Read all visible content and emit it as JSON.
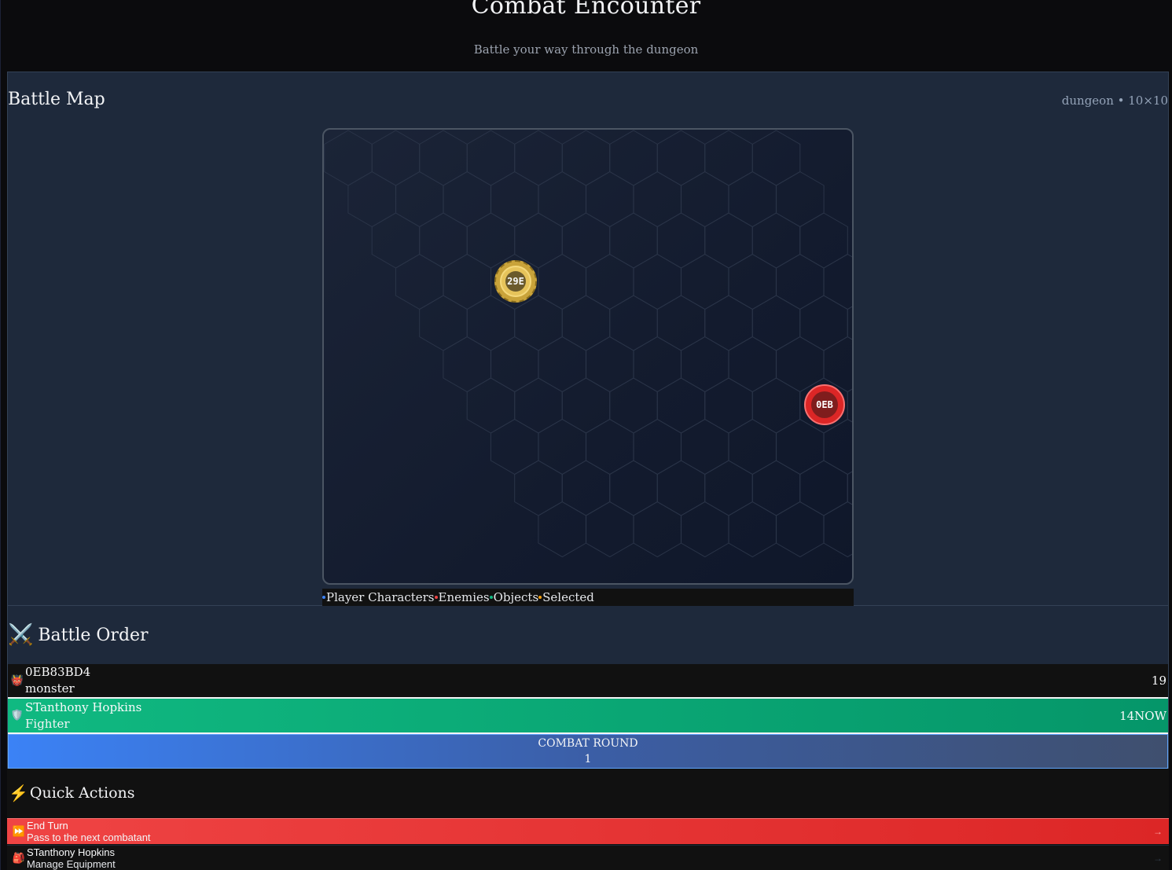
{
  "header": {
    "title": "Combat Encounter",
    "subtitle": "Battle your way through the dungeon"
  },
  "map": {
    "title": "Battle Map",
    "meta": "dungeon • 10×10",
    "tokens": [
      {
        "label": "29E",
        "kind": "player"
      },
      {
        "label": "0EB",
        "kind": "enemy"
      }
    ],
    "legend": [
      {
        "label": "Player Characters",
        "color": "#3b82f6"
      },
      {
        "label": "Enemies",
        "color": "#ef4444"
      },
      {
        "label": "Objects",
        "color": "#10b981"
      },
      {
        "label": "Selected",
        "color": "#f59e0b"
      }
    ]
  },
  "battle_order": {
    "title": "Battle Order",
    "icon": "crossed-swords-icon",
    "combatants": [
      {
        "name": "0EB83BD4",
        "type": "monster",
        "initiative": "19",
        "icon": "ogre-icon"
      },
      {
        "name": "STanthony Hopkins",
        "type": "Fighter",
        "initiative": "14NOW",
        "icon": "shield-icon"
      }
    ],
    "round_label": "COMBAT ROUND",
    "round_number": "1"
  },
  "quick_actions": {
    "title": "Quick Actions",
    "icon": "lightning-icon",
    "items": [
      {
        "label": "End Turn",
        "description": "Pass to the next combatant",
        "arrow": "→",
        "icon": "fast-forward-icon"
      },
      {
        "label": "STanthony Hopkins",
        "description": "Manage Equipment",
        "arrow": "→",
        "icon": "backpack-icon"
      }
    ]
  }
}
